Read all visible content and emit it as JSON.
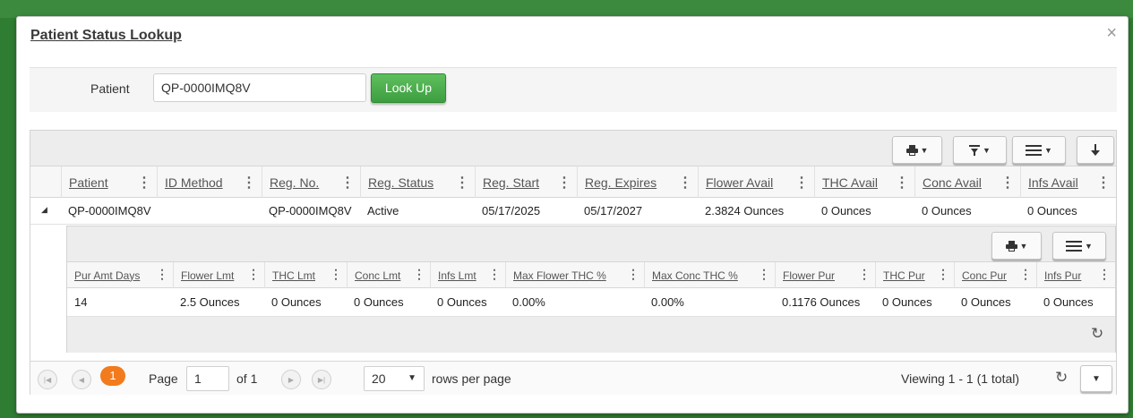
{
  "dialog": {
    "title": "Patient Status Lookup",
    "close_glyph": "×"
  },
  "lookup": {
    "patient_label": "Patient",
    "patient_value": "QP-0000IMQ8V",
    "button_label": "Look Up"
  },
  "toolbar": {
    "print_icon": "printer-icon",
    "filter_icon": "filter-icon",
    "columns_icon": "columns-menu-icon",
    "download_icon": "download-icon"
  },
  "grid": {
    "columns": [
      "Patient",
      "ID Method",
      "Reg. No.",
      "Reg. Status",
      "Reg. Start",
      "Reg. Expires",
      "Flower Avail",
      "THC Avail",
      "Conc Avail",
      "Infs Avail"
    ],
    "rows": [
      [
        "QP-0000IMQ8V",
        "",
        "QP-0000IMQ8V",
        "Active",
        "05/17/2025",
        "05/17/2027",
        "2.3824 Ounces",
        "0 Ounces",
        "0 Ounces",
        "0 Ounces"
      ]
    ]
  },
  "subgrid": {
    "columns": [
      "Pur Amt Days",
      "Flower Lmt",
      "THC Lmt",
      "Conc Lmt",
      "Infs Lmt",
      "Max Flower THC %",
      "Max Conc THC %",
      "Flower Pur",
      "THC Pur",
      "Conc Pur",
      "Infs Pur"
    ],
    "rows": [
      [
        "14",
        "2.5 Ounces",
        "0 Ounces",
        "0 Ounces",
        "0 Ounces",
        "0.00%",
        "0.00%",
        "0.1176 Ounces",
        "0 Ounces",
        "0 Ounces",
        "0 Ounces"
      ]
    ]
  },
  "pager": {
    "current_page": "1",
    "page_label": "Page",
    "page_input": "1",
    "of_label": "of 1",
    "rows_per_page_value": "20",
    "rows_per_page_label": "rows per page",
    "viewing_text": "Viewing 1 - 1 (1 total)"
  },
  "colors": {
    "accent_green": "#3d9e40",
    "page_badge": "#f27b1d",
    "background": "#2f7d32"
  }
}
